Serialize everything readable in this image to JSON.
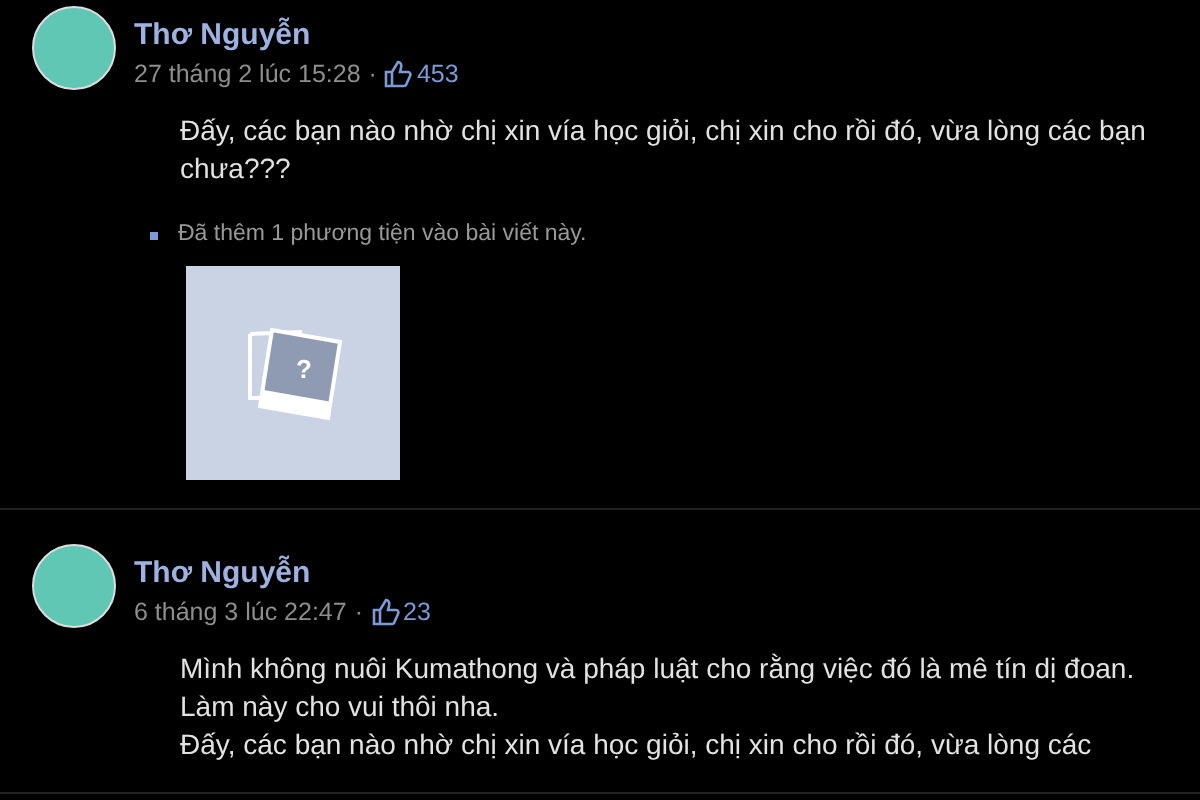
{
  "posts": [
    {
      "author": "Thơ Nguyễn",
      "time": "27 tháng 2 lúc 15:28",
      "separator": "·",
      "likes": "453",
      "paragraphs": [
        "Đấy, các bạn nào nhờ chị xin vía học giỏi, chị xin cho rồi đó, vừa lòng các bạn chưa???"
      ],
      "attachments": [
        {
          "caption": "Đã thêm 1 phương tiện vào bài viết này.",
          "symbol": "?"
        }
      ]
    },
    {
      "author": "Thơ Nguyễn",
      "time": "6 tháng 3 lúc 22:47",
      "separator": "·",
      "likes": "23",
      "paragraphs": [
        "Mình không nuôi Kumathong và pháp luật cho rằng việc đó là mê tín dị đoan.",
        "Làm này cho vui thôi nha.",
        "Đấy, các bạn nào nhờ chị xin vía học giỏi, chị xin cho rồi đó, vừa lòng các"
      ]
    }
  ]
}
